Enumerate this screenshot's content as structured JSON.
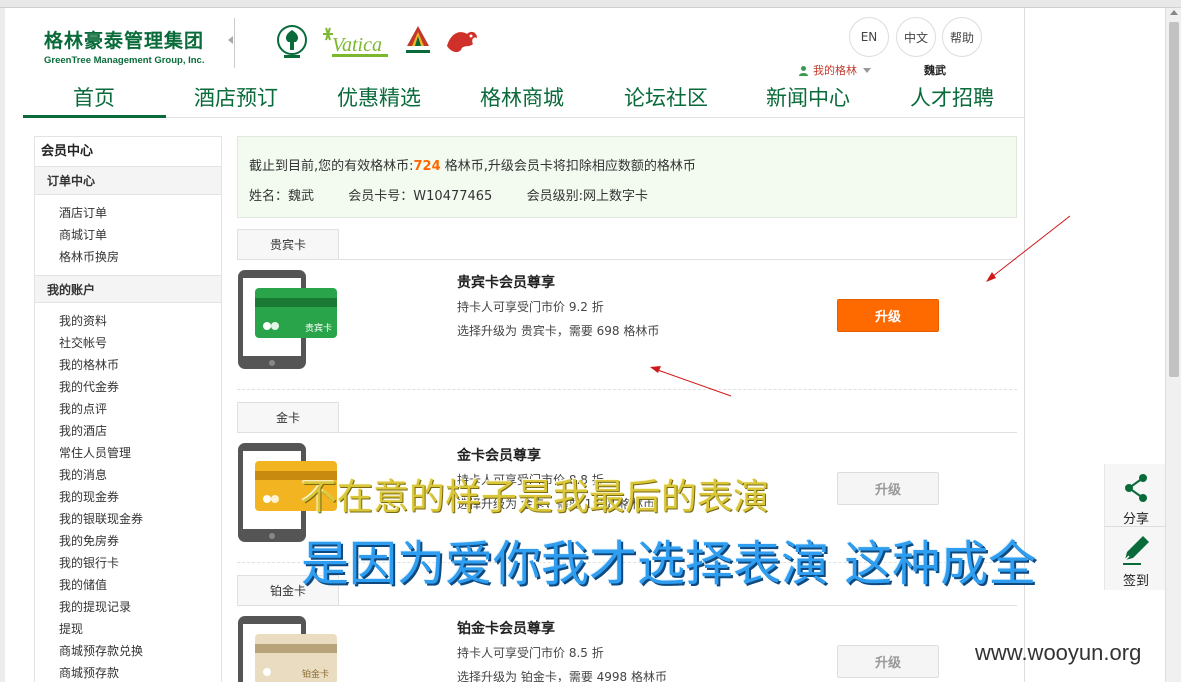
{
  "header": {
    "logo_cn": "格林豪泰管理集团",
    "logo_en": "GreenTree  Management Group, Inc.",
    "lang_en": "EN",
    "lang_cn": "中文",
    "help": "帮助",
    "my_greentree": "我的格林",
    "username": "魏武"
  },
  "brands": [
    {
      "name": "greentree-inns-logo",
      "color": "#0a6b3a"
    },
    {
      "name": "vatica-logo",
      "text": "Vatica",
      "color": "#7cb82f"
    },
    {
      "name": "alyi-hotels-logo",
      "color": "#c0392b"
    },
    {
      "name": "dragon-logo",
      "color": "#d0302a"
    }
  ],
  "nav": {
    "items": [
      "首页",
      "酒店预订",
      "优惠精选",
      "格林商城",
      "论坛社区",
      "新闻中心",
      "人才招聘"
    ],
    "active_index": 0
  },
  "sidebar": {
    "title": "会员中心",
    "sections": [
      {
        "label": "订单中心",
        "items": [
          "酒店订单",
          "商城订单",
          "格林币换房"
        ]
      },
      {
        "label": "我的账户",
        "items": [
          "我的资料",
          "社交帐号",
          "我的格林币",
          "我的代金券",
          "我的点评",
          "我的酒店",
          "常住人员管理",
          "我的消息",
          "我的现金券",
          "我的银联现金券",
          "我的免房券",
          "我的银行卡",
          "我的储值",
          "我的提现记录",
          "提现",
          "商城预存款兑换",
          "商城预存款"
        ]
      }
    ]
  },
  "info": {
    "line1_prefix": "截止到目前,您的有效格林币:",
    "coins": "724",
    "line1_suffix": " 格林币,升级会员卡将扣除相应数额的格林币",
    "name_label": "姓名：魏武",
    "card_no": "会员卡号：W10477465",
    "level": "会员级别:网上数字卡"
  },
  "cards": [
    {
      "tab": "贵宾卡",
      "title": "贵宾卡会员尊享",
      "line1": "持卡人可享受门市价 9.2 折",
      "line2": "选择升级为 贵宾卡，需要 698 格林币",
      "button": "升级",
      "enabled": true,
      "card_label": "贵宾卡",
      "card_color": "#2aa44a"
    },
    {
      "tab": "金卡",
      "title": "金卡会员尊享",
      "line1": "持卡人可享受门市价 8.8 折",
      "line2": "选择升级为 金卡，需要 1998 格林币",
      "button": "升级",
      "enabled": false,
      "card_label": "",
      "card_color": "#f2b420"
    },
    {
      "tab": "铂金卡",
      "title": "铂金卡会员尊享",
      "line1": "持卡人可享受门市价 8.5 折",
      "line2": "选择升级为 铂金卡，需要 4998 格林币",
      "button": "升级",
      "enabled": false,
      "card_label": "铂金卡",
      "card_color": "#e9dcc0"
    }
  ],
  "overlay": {
    "line1": "不在意的样子是我最后的表演",
    "line2": "是因为爱你我才选择表演 这种成全"
  },
  "share": {
    "share_label": "分享",
    "signin_label": "签到"
  },
  "watermark": "www.wooyun.org"
}
